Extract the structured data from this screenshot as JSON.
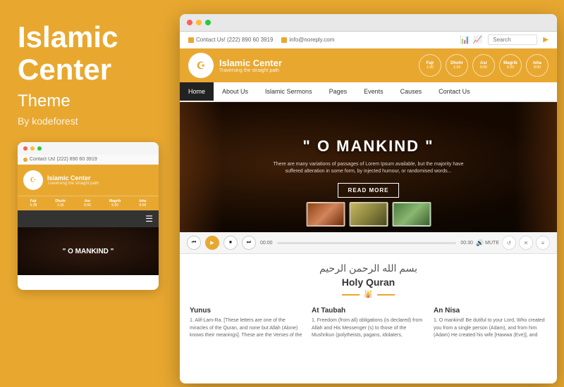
{
  "left": {
    "title": "Islamic\nCenter",
    "subtitle": "Theme",
    "by": "By kodeforest"
  },
  "mobile": {
    "contact_text": "Contact Us! (222) 890 60 3919",
    "header_title": "Islamic Center",
    "header_sub": "Traversing the straight path",
    "prayer_times": [
      {
        "name": "Fajr",
        "time": "5:30"
      },
      {
        "name": "Dhuhr",
        "time": "1:35"
      },
      {
        "name": "Asr",
        "time": "5:06"
      },
      {
        "name": "Magrib",
        "time": "6:00"
      },
      {
        "name": "Isha",
        "time": "8:00"
      }
    ],
    "hero_text": "\" O MANKIND \""
  },
  "browser": {
    "topbar": {
      "contact": "Contact Us! (222) 890 60 3919",
      "email": "info@noreply.com",
      "search_placeholder": "Search"
    },
    "header": {
      "site_title": "Islamic Center",
      "site_tagline": "Traversing the straight path",
      "prayer_times": [
        {
          "name": "Fajr",
          "time": "1:30"
        },
        {
          "name": "Dhohr",
          "time": "1:34"
        },
        {
          "name": "Asr",
          "time": "5:00"
        },
        {
          "name": "Magrib",
          "time": "6:39"
        },
        {
          "name": "Isha",
          "time": "8:00"
        }
      ]
    },
    "nav": {
      "items": [
        "Home",
        "About Us",
        "Islamic Sermons",
        "Pages",
        "Events",
        "Causes",
        "Contact Us"
      ],
      "active": "Home"
    },
    "hero": {
      "quote": "O MANKIND",
      "description": "There are many variations of passages of Lorem Ipsum available, but the majority have suffered alteration in some form, by injected humour, or randomised words...",
      "btn_label": "READ MORE"
    },
    "player": {
      "time_start": "00:00",
      "time_end": "00:30",
      "mute_label": "MUTE"
    },
    "quran": {
      "arabic": "بسم الله الرحمن الرحيم",
      "title": "Holy Quran"
    },
    "columns": [
      {
        "title": "Yunus",
        "text": "1. Alif-Lam-Ra. [These letters are one of the miracles of the Quran, and none but Allah (Alone) knows their meanings]. These are the Verses of the"
      },
      {
        "title": "At Taubah",
        "text": "1. Freedom (from all) obligations (is declared) from Allah and His Messenger (s) to those of the Mushrikun (polytheists, pagans, idolaters,"
      },
      {
        "title": "An Nisa",
        "text": "1. O mankind! Be dutiful to your Lord, Who created you from a single person (Adam), and from him (Adam) He created his wife [Hawwa (Eve)], and"
      }
    ]
  }
}
